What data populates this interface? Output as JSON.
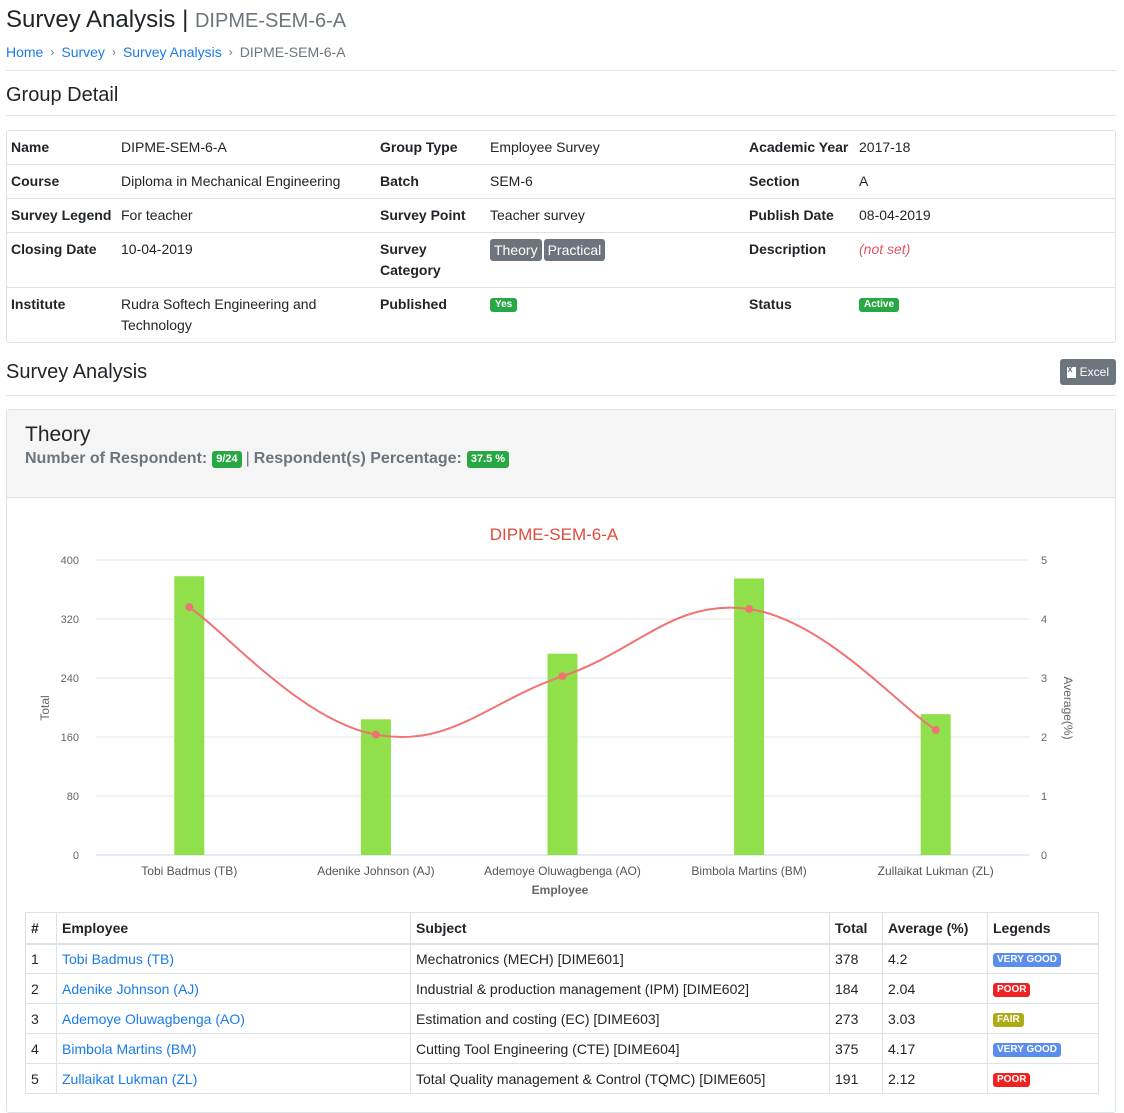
{
  "header": {
    "title": "Survey Analysis",
    "separator": "|",
    "subtitle": "DIPME-SEM-6-A"
  },
  "breadcrumb": {
    "items": [
      {
        "label": "Home"
      },
      {
        "label": "Survey"
      },
      {
        "label": "Survey Analysis"
      }
    ],
    "current": "DIPME-SEM-6-A",
    "separator": "›"
  },
  "group_detail": {
    "title": "Group Detail",
    "rows": [
      [
        {
          "label": "Name",
          "value": "DIPME-SEM-6-A"
        },
        {
          "label": "Group Type",
          "value": "Employee Survey"
        },
        {
          "label": "Academic Year",
          "value": "2017-18"
        }
      ],
      [
        {
          "label": "Course",
          "value": "Diploma in Mechanical Engineering"
        },
        {
          "label": "Batch",
          "value": "SEM-6"
        },
        {
          "label": "Section",
          "value": "A"
        }
      ],
      [
        {
          "label": "Survey Legend",
          "value": "For teacher"
        },
        {
          "label": "Survey Point",
          "value": "Teacher survey"
        },
        {
          "label": "Publish Date",
          "value": "08-04-2019"
        }
      ],
      [
        {
          "label": "Closing Date",
          "value": "10-04-2019"
        },
        {
          "label": "Survey Category",
          "badges": [
            "Theory",
            "Practical"
          ]
        },
        {
          "label": "Description",
          "value": "(not set)"
        }
      ],
      [
        {
          "label": "Institute",
          "value": "Rudra Softech Engineering and Technology"
        },
        {
          "label": "Published",
          "badge": "Yes"
        },
        {
          "label": "Status",
          "badge": "Active"
        }
      ]
    ]
  },
  "analysis": {
    "title": "Survey Analysis",
    "excel_label": "Excel",
    "excel_icon": "file-excel-icon",
    "card": {
      "title": "Theory",
      "respondent_label": "Number of Respondent:",
      "respondent_value": "9/24",
      "divider": "|",
      "percentage_label": "Respondent(s) Percentage:",
      "percentage_value": "37.5 %"
    }
  },
  "chart_data": {
    "type": "bar",
    "title": "DIPME-SEM-6-A",
    "categories": [
      "Tobi Badmus (TB)",
      "Adenike Johnson (AJ)",
      "Ademoye Oluwagbenga (AO)",
      "Bimbola Martins (BM)",
      "Zullaikat Lukman (ZL)"
    ],
    "series": [
      {
        "name": "Total",
        "type": "bar",
        "axis": "left",
        "color": "#8fe04a",
        "values": [
          378,
          184,
          273,
          375,
          191
        ]
      },
      {
        "name": "Average(%)",
        "type": "line",
        "smooth": true,
        "axis": "right",
        "color": "#f07474",
        "values": [
          4.2,
          2.04,
          3.03,
          4.17,
          2.12
        ]
      }
    ],
    "xlabel": "Employee",
    "ylabel": "Total",
    "ylabel_right": "Average(%)",
    "ylim": [
      0,
      400
    ],
    "yticks": [
      0,
      80,
      160,
      240,
      320,
      400
    ],
    "ylim_right": [
      0,
      5
    ],
    "yticks_right": [
      0,
      1,
      2,
      3,
      4,
      5
    ],
    "grid": true,
    "title_color": "#e04b3a"
  },
  "table": {
    "columns": [
      "#",
      "Employee",
      "Subject",
      "Total",
      "Average (%)",
      "Legends"
    ],
    "rows": [
      {
        "no": "1",
        "employee": "Tobi Badmus (TB)",
        "subject": "Mechatronics (MECH) [DIME601]",
        "total": "378",
        "average": "4.2",
        "legend": "VERY GOOD",
        "legend_color": "#5b8def"
      },
      {
        "no": "2",
        "employee": "Adenike Johnson (AJ)",
        "subject": "Industrial & production management (IPM) [DIME602]",
        "total": "184",
        "average": "2.04",
        "legend": "POOR",
        "legend_color": "#ee2222"
      },
      {
        "no": "3",
        "employee": "Ademoye Oluwagbenga (AO)",
        "subject": "Estimation and costing (EC) [DIME603]",
        "total": "273",
        "average": "3.03",
        "legend": "FAIR",
        "legend_color": "#aeaa18"
      },
      {
        "no": "4",
        "employee": "Bimbola Martins (BM)",
        "subject": "Cutting Tool Engineering (CTE) [DIME604]",
        "total": "375",
        "average": "4.17",
        "legend": "VERY GOOD",
        "legend_color": "#5b8def"
      },
      {
        "no": "5",
        "employee": "Zullaikat Lukman (ZL)",
        "subject": "Total Quality management & Control (TQMC) [DIME605]",
        "total": "191",
        "average": "2.12",
        "legend": "POOR",
        "legend_color": "#ee2222"
      }
    ]
  }
}
